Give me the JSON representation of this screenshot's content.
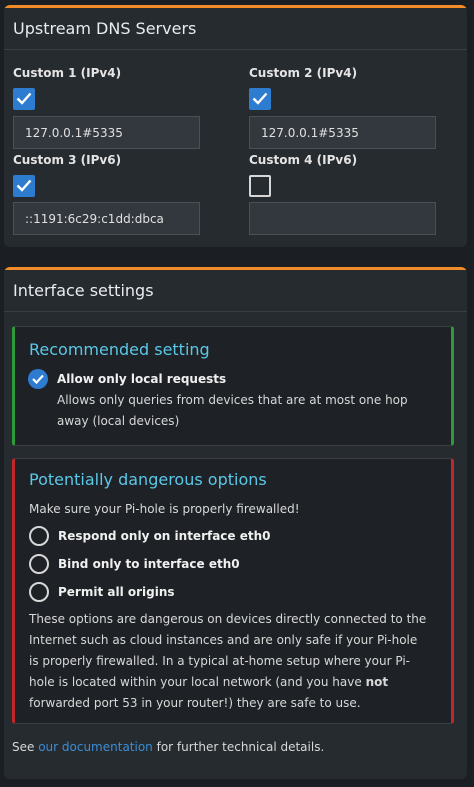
{
  "upstream": {
    "title": "Upstream DNS Servers",
    "servers": [
      {
        "label": "Custom 1 (IPv4)",
        "checked": true,
        "value": "127.0.0.1#5335"
      },
      {
        "label": "Custom 2 (IPv4)",
        "checked": true,
        "value": "127.0.0.1#5335"
      },
      {
        "label": "Custom 3 (IPv6)",
        "checked": true,
        "value": "::1191:6c29:c1dd:dbca"
      },
      {
        "label": "Custom 4 (IPv6)",
        "checked": false,
        "value": ""
      }
    ]
  },
  "interface": {
    "title": "Interface settings",
    "recommended": {
      "title": "Recommended setting",
      "option_label": "Allow only local requests",
      "description": "Allows only queries from devices that are at most one hop away (local devices)"
    },
    "dangerous": {
      "title": "Potentially dangerous options",
      "warning": "Make sure your Pi-hole is properly firewalled!",
      "options": [
        "Respond only on interface eth0",
        "Bind only to interface eth0",
        "Permit all origins"
      ],
      "note_before": "These options are dangerous on devices directly connected to the Internet such as cloud instances and are only safe if your Pi-hole is properly firewalled. In a typical at-home setup where your Pi-hole is located within your local network (and you have ",
      "note_bold": "not",
      "note_after": " forwarded port 53 in your router!) they are safe to use."
    },
    "footer": {
      "prefix": "See ",
      "link": "our documentation",
      "suffix": " for further technical details."
    }
  },
  "colors": {
    "accent_top": "#f28c28",
    "check_blue": "#2e7cd0",
    "title_cyan": "#5bc8e8",
    "green_border": "#2f9a3a",
    "red_border": "#c0262a",
    "link": "#3c8dd6"
  }
}
